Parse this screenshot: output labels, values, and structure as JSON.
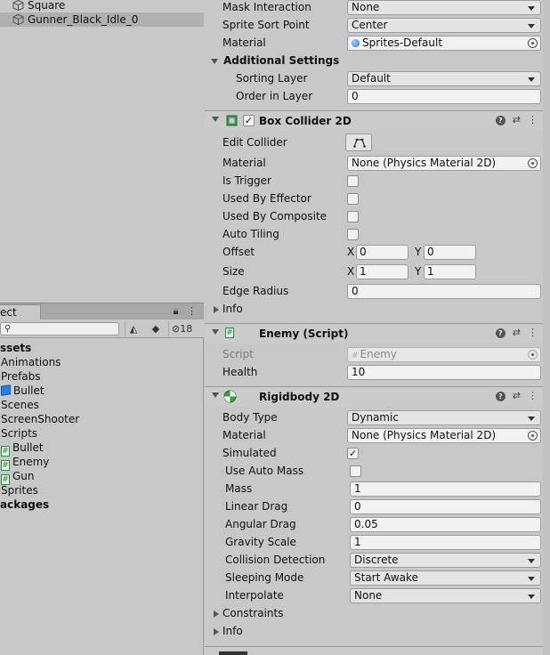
{
  "hierarchy": {
    "items": [
      {
        "label": "Square"
      },
      {
        "label": "Gunner_Black_Idle_0",
        "selected": true
      }
    ]
  },
  "project": {
    "tab_label": "ect",
    "hidden_count": "18",
    "tree": [
      {
        "label": "ssets",
        "bold": true
      },
      {
        "label": "Animations"
      },
      {
        "label": "Prefabs"
      },
      {
        "label": "Bullet",
        "icon": "prefab-cube-icon"
      },
      {
        "label": "Scenes"
      },
      {
        "label": "ScreenShooter"
      },
      {
        "label": "Scripts"
      },
      {
        "label": "Bullet",
        "icon": "script-icon"
      },
      {
        "label": "Enemy",
        "icon": "script-icon"
      },
      {
        "label": "Gun",
        "icon": "script-icon"
      },
      {
        "label": "Sprites"
      },
      {
        "label": "ackages",
        "bold": true
      }
    ]
  },
  "sprite_renderer": {
    "mask_interaction_label": "Mask Interaction",
    "mask_interaction_value": "None",
    "sprite_sort_point_label": "Sprite Sort Point",
    "sprite_sort_point_value": "Center",
    "material_label": "Material",
    "material_value": "Sprites-Default",
    "additional_settings_label": "Additional Settings",
    "sorting_layer_label": "Sorting Layer",
    "sorting_layer_value": "Default",
    "order_in_layer_label": "Order in Layer",
    "order_in_layer_value": "0"
  },
  "box_collider": {
    "title": "Box Collider 2D",
    "enabled": "✓",
    "edit_collider_label": "Edit Collider",
    "material_label": "Material",
    "material_value": "None (Physics Material 2D)",
    "is_trigger_label": "Is Trigger",
    "used_by_effector_label": "Used By Effector",
    "used_by_composite_label": "Used By Composite",
    "auto_tiling_label": "Auto Tiling",
    "offset_label": "Offset",
    "offset_x": "0",
    "offset_y": "0",
    "size_label": "Size",
    "size_x": "1",
    "size_y": "1",
    "edge_radius_label": "Edge Radius",
    "edge_radius_value": "0",
    "info_label": "Info",
    "x_label": "X",
    "y_label": "Y"
  },
  "enemy_script": {
    "title": "Enemy (Script)",
    "script_label": "Script",
    "script_value": "Enemy",
    "health_label": "Health",
    "health_value": "10"
  },
  "rigidbody": {
    "title": "Rigidbody 2D",
    "body_type_label": "Body Type",
    "body_type_value": "Dynamic",
    "material_label": "Material",
    "material_value": "None (Physics Material 2D)",
    "simulated_label": "Simulated",
    "simulated_check": "✓",
    "use_auto_mass_label": "Use Auto Mass",
    "mass_label": "Mass",
    "mass_value": "1",
    "linear_drag_label": "Linear Drag",
    "linear_drag_value": "0",
    "angular_drag_label": "Angular Drag",
    "angular_drag_value": "0.05",
    "gravity_scale_label": "Gravity Scale",
    "gravity_scale_value": "1",
    "collision_detection_label": "Collision Detection",
    "collision_detection_value": "Discrete",
    "sleeping_mode_label": "Sleeping Mode",
    "sleeping_mode_value": "Start Awake",
    "interpolate_label": "Interpolate",
    "interpolate_value": "None",
    "constraints_label": "Constraints",
    "info_label": "Info"
  },
  "colors": {
    "panel_bg": "#c8c8c8",
    "field_bg": "#f2f2f2",
    "selection": "#b0b0b0",
    "script_green": "#2b8a3e",
    "prefab_blue": "#2d7de0"
  }
}
